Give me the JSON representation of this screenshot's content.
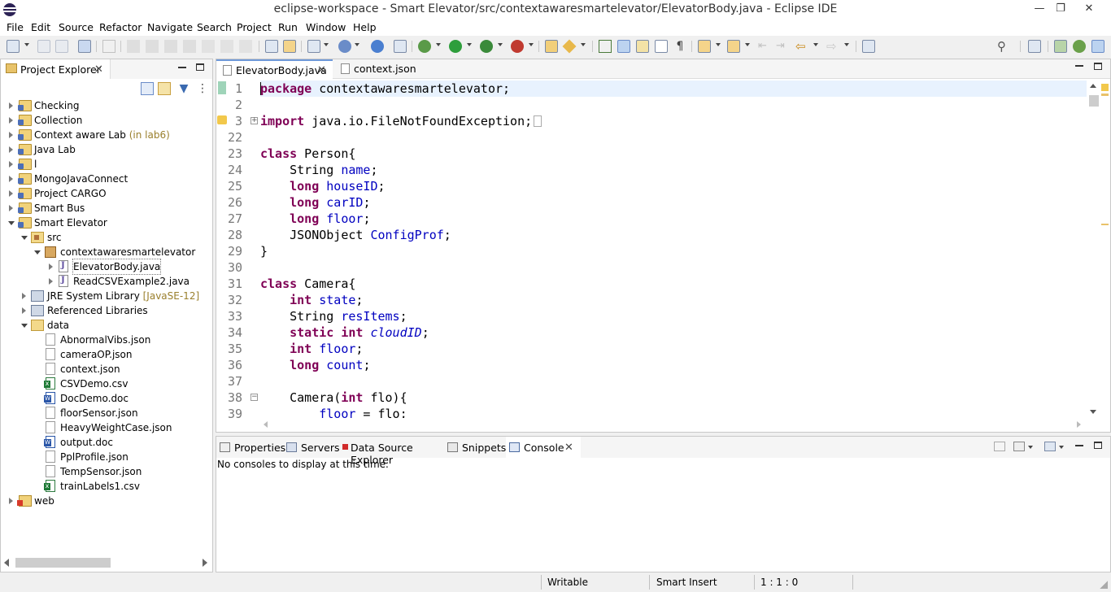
{
  "window": {
    "title": "eclipse-workspace - Smart Elevator/src/contextawaresmartelevator/ElevatorBody.java - Eclipse IDE"
  },
  "menu": [
    "File",
    "Edit",
    "Source",
    "Refactor",
    "Navigate",
    "Search",
    "Project",
    "Run",
    "Window",
    "Help"
  ],
  "project_explorer": {
    "title": "Project Explorer",
    "tree": [
      {
        "label": "Checking",
        "icon": "project-icon",
        "state": "collapsed"
      },
      {
        "label": "Collection",
        "icon": "project-icon",
        "state": "collapsed"
      },
      {
        "label": "Context aware Lab",
        "decoration": "(in lab6)",
        "icon": "project-icon",
        "state": "collapsed"
      },
      {
        "label": "Java Lab",
        "icon": "project-icon",
        "state": "collapsed"
      },
      {
        "label": "l",
        "icon": "project-icon",
        "state": "collapsed"
      },
      {
        "label": "MongoJavaConnect",
        "icon": "project-icon",
        "state": "collapsed"
      },
      {
        "label": "Project CARGO",
        "icon": "project-icon",
        "state": "collapsed"
      },
      {
        "label": "Smart Bus",
        "icon": "project-icon",
        "state": "collapsed"
      },
      {
        "label": "Smart Elevator",
        "icon": "project-icon",
        "state": "expanded"
      },
      {
        "label": "src",
        "icon": "source-folder-icon",
        "state": "expanded"
      },
      {
        "label": "contextawaresmartelevator",
        "icon": "package-icon",
        "state": "expanded"
      },
      {
        "label": "ElevatorBody.java",
        "icon": "java-file-icon",
        "state": "collapsed",
        "selected": true
      },
      {
        "label": "ReadCSVExample2.java",
        "icon": "java-file-icon",
        "state": "collapsed"
      },
      {
        "label": "JRE System Library",
        "decoration": "[JavaSE-12]",
        "icon": "library-icon",
        "state": "collapsed"
      },
      {
        "label": "Referenced Libraries",
        "icon": "library-icon",
        "state": "collapsed"
      },
      {
        "label": "data",
        "icon": "folder-icon",
        "state": "expanded"
      },
      {
        "label": "AbnormalVibs.json",
        "icon": "file-icon"
      },
      {
        "label": "cameraOP.json",
        "icon": "file-icon"
      },
      {
        "label": "context.json",
        "icon": "file-icon"
      },
      {
        "label": "CSVDemo.csv",
        "icon": "excel-file-icon"
      },
      {
        "label": "DocDemo.doc",
        "icon": "word-file-icon"
      },
      {
        "label": "floorSensor.json",
        "icon": "file-icon"
      },
      {
        "label": "HeavyWeightCase.json",
        "icon": "file-icon"
      },
      {
        "label": "output.doc",
        "icon": "word-file-icon"
      },
      {
        "label": "PplProfile.json",
        "icon": "file-icon"
      },
      {
        "label": "TempSensor.json",
        "icon": "file-icon"
      },
      {
        "label": "trainLabels1.csv",
        "icon": "excel-file-icon"
      },
      {
        "label": "web",
        "icon": "web-project-icon",
        "state": "collapsed"
      }
    ]
  },
  "editor": {
    "tabs": [
      {
        "label": "ElevatorBody.java",
        "active": true
      },
      {
        "label": "context.json",
        "active": false
      }
    ],
    "lines": [
      {
        "num": "1",
        "tokens": [
          [
            "kw",
            "package"
          ],
          [
            "t",
            " contextawaresmartelevator;"
          ]
        ],
        "current": true
      },
      {
        "num": "2",
        "tokens": []
      },
      {
        "num": "3",
        "tokens": [
          [
            "kw",
            "import"
          ],
          [
            "t",
            " java.io.FileNotFoundException;"
          ]
        ],
        "folded": true
      },
      {
        "num": "22",
        "tokens": []
      },
      {
        "num": "23",
        "tokens": [
          [
            "kw",
            "class"
          ],
          [
            "t",
            " Person{"
          ]
        ]
      },
      {
        "num": "24",
        "tokens": [
          [
            "t",
            "    String "
          ],
          [
            "f",
            "name"
          ],
          [
            "t",
            ";"
          ]
        ]
      },
      {
        "num": "25",
        "tokens": [
          [
            "t",
            "    "
          ],
          [
            "kw",
            "long"
          ],
          [
            "t",
            " "
          ],
          [
            "f",
            "houseID"
          ],
          [
            "t",
            ";"
          ]
        ]
      },
      {
        "num": "26",
        "tokens": [
          [
            "t",
            "    "
          ],
          [
            "kw",
            "long"
          ],
          [
            "t",
            " "
          ],
          [
            "f",
            "carID"
          ],
          [
            "t",
            ";"
          ]
        ]
      },
      {
        "num": "27",
        "tokens": [
          [
            "t",
            "    "
          ],
          [
            "kw",
            "long"
          ],
          [
            "t",
            " "
          ],
          [
            "f",
            "floor"
          ],
          [
            "t",
            ";"
          ]
        ]
      },
      {
        "num": "28",
        "tokens": [
          [
            "t",
            "    JSONObject "
          ],
          [
            "f",
            "ConfigProf"
          ],
          [
            "t",
            ";"
          ]
        ]
      },
      {
        "num": "29",
        "tokens": [
          [
            "t",
            "}"
          ]
        ]
      },
      {
        "num": "30",
        "tokens": []
      },
      {
        "num": "31",
        "tokens": [
          [
            "kw",
            "class"
          ],
          [
            "t",
            " Camera{"
          ]
        ]
      },
      {
        "num": "32",
        "tokens": [
          [
            "t",
            "    "
          ],
          [
            "kw",
            "int"
          ],
          [
            "t",
            " "
          ],
          [
            "f",
            "state"
          ],
          [
            "t",
            ";"
          ]
        ]
      },
      {
        "num": "33",
        "tokens": [
          [
            "t",
            "    String "
          ],
          [
            "f",
            "resItems"
          ],
          [
            "t",
            ";"
          ]
        ]
      },
      {
        "num": "34",
        "tokens": [
          [
            "t",
            "    "
          ],
          [
            "kw",
            "static"
          ],
          [
            "t",
            " "
          ],
          [
            "kw",
            "int"
          ],
          [
            "t",
            " "
          ],
          [
            "sf",
            "cloudID"
          ],
          [
            "t",
            ";"
          ]
        ]
      },
      {
        "num": "35",
        "tokens": [
          [
            "t",
            "    "
          ],
          [
            "kw",
            "int"
          ],
          [
            "t",
            " "
          ],
          [
            "f",
            "floor"
          ],
          [
            "t",
            ";"
          ]
        ]
      },
      {
        "num": "36",
        "tokens": [
          [
            "t",
            "    "
          ],
          [
            "kw",
            "long"
          ],
          [
            "t",
            " "
          ],
          [
            "f",
            "count"
          ],
          [
            "t",
            ";"
          ]
        ]
      },
      {
        "num": "37",
        "tokens": []
      },
      {
        "num": "38",
        "tokens": [
          [
            "t",
            "    Camera("
          ],
          [
            "kw",
            "int"
          ],
          [
            "t",
            " flo){"
          ]
        ],
        "foldable": true
      },
      {
        "num": "39",
        "tokens": [
          [
            "t",
            "        "
          ],
          [
            "f",
            "floor"
          ],
          [
            "t",
            " = flo;"
          ]
        ]
      }
    ]
  },
  "bottom_panel": {
    "tabs": [
      {
        "label": "Properties",
        "active": false
      },
      {
        "label": "Servers",
        "active": false
      },
      {
        "label": "Data Source Explorer",
        "active": false
      },
      {
        "label": "Snippets",
        "active": false
      },
      {
        "label": "Console",
        "active": true
      }
    ],
    "message": "No consoles to display at this time."
  },
  "status_bar": {
    "mode": "Writable",
    "insert": "Smart Insert",
    "position": "1 : 1 : 0"
  }
}
